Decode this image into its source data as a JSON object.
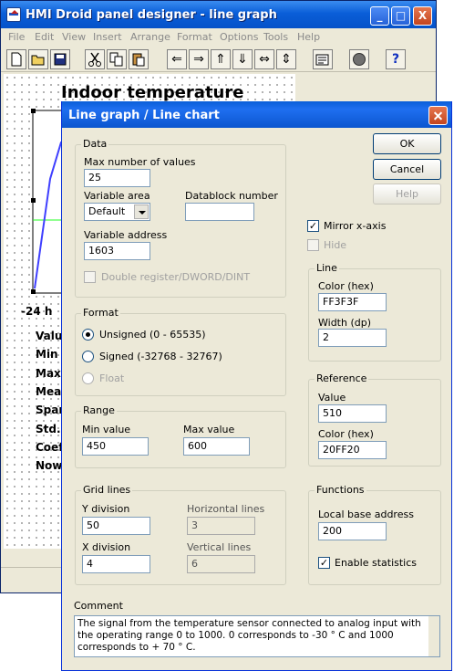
{
  "main": {
    "title": "HMI Droid panel designer - line graph",
    "window_buttons": {
      "minimize": "_",
      "maximize": "□",
      "close": "X"
    },
    "menu": [
      "File",
      "Edit",
      "View",
      "Insert",
      "Arrange",
      "Format",
      "Options",
      "Tools",
      "Help"
    ],
    "toolbar": [
      "new-icon",
      "open-icon",
      "save-icon",
      "cut-icon",
      "copy-icon",
      "paste-icon",
      "align-left-icon",
      "align-right-icon",
      "align-top-icon",
      "align-bottom-icon",
      "same-width-icon",
      "same-height-icon",
      "properties-icon",
      "record-icon",
      "help-icon"
    ],
    "toolbar_glyphs": {
      "align_left": "⇐",
      "align_right": "⇒",
      "align_top": "⇑",
      "align_bottom": "⇓",
      "same_width": "⇔",
      "same_height": "⇕",
      "help": "?"
    },
    "canvas": {
      "title": "Indoor temperature",
      "time_label": "-24 h",
      "stats": [
        "Valu",
        "Min v",
        "Max",
        "Mea",
        "Spar",
        "Std.",
        "Coef",
        "Now"
      ]
    }
  },
  "dialog": {
    "title": "Line graph / Line chart",
    "data": {
      "legend": "Data",
      "max_values_label": "Max number of values",
      "max_values": "25",
      "variable_area_label": "Variable area",
      "variable_area": "Default",
      "datablock_label": "Datablock number",
      "datablock": "",
      "variable_address_label": "Variable address",
      "variable_address": "1603",
      "double_register_label": "Double register/DWORD/DINT"
    },
    "format": {
      "legend": "Format",
      "options": [
        "Unsigned (0 - 65535)",
        "Signed (-32768 - 32767)",
        "Float"
      ],
      "selected": "Unsigned (0 - 65535)"
    },
    "range": {
      "legend": "Range",
      "min_label": "Min value",
      "min": "450",
      "max_label": "Max value",
      "max": "600"
    },
    "grid": {
      "legend": "Grid lines",
      "y_label": "Y division",
      "y": "50",
      "x_label": "X division",
      "x": "4",
      "horizontal_label": "Horizontal lines",
      "horizontal": "3",
      "vertical_label": "Vertical lines",
      "vertical": "6"
    },
    "buttons": {
      "ok": "OK",
      "cancel": "Cancel",
      "help": "Help"
    },
    "mirror_label": "Mirror x-axis",
    "mirror_checked": true,
    "hide_label": "Hide",
    "line": {
      "legend": "Line",
      "color_label": "Color (hex)",
      "color": "FF3F3F",
      "width_label": "Width (dp)",
      "width": "2"
    },
    "reference": {
      "legend": "Reference",
      "value_label": "Value",
      "value": "510",
      "color_label": "Color (hex)",
      "color": "20FF20"
    },
    "functions": {
      "legend": "Functions",
      "base_label": "Local base address",
      "base": "200",
      "stats_label": "Enable statistics",
      "stats_checked": true
    },
    "comment_label": "Comment",
    "comment": "The signal from the temperature sensor connected to analog input with the operating range 0 to 1000. 0 corresponds to -30 ° C and 1000 corresponds to + 70 ° C.",
    "check_mark": "✓"
  },
  "colors": {
    "title_blue": "#0a5ed8",
    "dialog_bg": "#ece9d8",
    "graph_line": "#3f3fff",
    "reference_line": "#20ff20"
  }
}
